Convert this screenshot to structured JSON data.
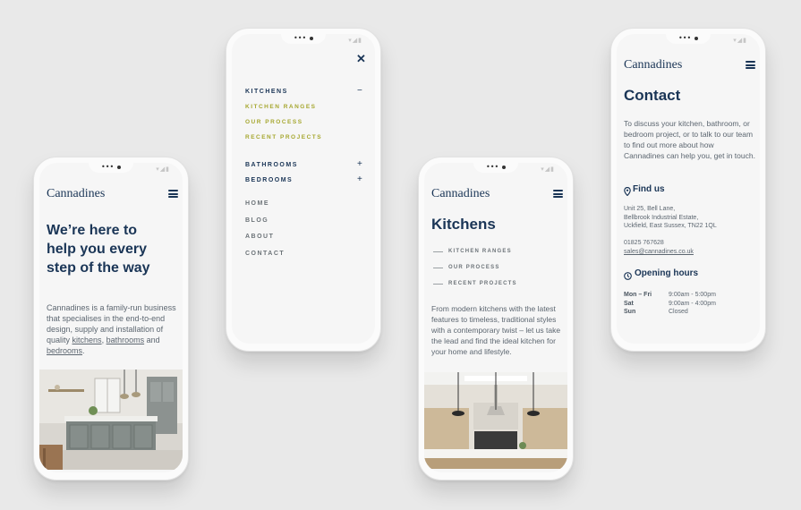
{
  "status_dots": "•••",
  "brand": "Cannadines",
  "phone1": {
    "headline": [
      "We’re here to",
      "help you every",
      "step of the way"
    ],
    "intro_text": "Cannadines is a family-run business that specialises in the end-to-end design, supply and installation of quality",
    "links": [
      "kitchens",
      "bathrooms",
      "bedrooms"
    ],
    "and": "and",
    "period": ".",
    "comma": ","
  },
  "phone2": {
    "kitchens": "KITCHENS",
    "kitchens_toggle": "−",
    "sub_items": [
      "KITCHEN RANGES",
      "OUR PROCESS",
      "RECENT PROJECTS"
    ],
    "bathrooms": "BATHROOMS",
    "bedrooms": "BEDROOMS",
    "expand_toggle": "+",
    "minor_items": [
      "HOME",
      "BLOG",
      "ABOUT",
      "CONTACT"
    ],
    "close": "✕"
  },
  "phone3": {
    "title": "Kitchens",
    "side_items": [
      "KITCHEN RANGES",
      "OUR PROCESS",
      "RECENT PROJECTS"
    ],
    "text": "From modern kitchens with the latest features to timeless, traditional styles with a contemporary twist – let us take the lead and find the ideal kitchen for your home and lifestyle."
  },
  "phone4": {
    "title": "Contact",
    "text": "To discuss your kitchen, bathroom, or bedroom project, or to talk to our team to find out more about how Cannadines can help you, get in touch.",
    "find_us": "Find us",
    "address": [
      "Unit 25, Bell Lane,",
      "Bellbrook Industrial Estate,",
      "Uckfield, East Sussex, TN22 1QL"
    ],
    "phone": "01825 767628",
    "email": "sales@cannadines.co.uk",
    "hours_title": "Opening hours",
    "hours": [
      {
        "day": "Mon – Fri",
        "time": "9:00am - 5:00pm"
      },
      {
        "day": "Sat",
        "time": "9:00am - 4:00pm"
      },
      {
        "day": "Sun",
        "time": "Closed"
      }
    ]
  },
  "colors": {
    "navy": "#1a3556",
    "olive": "#a6a72f",
    "grey_text": "#5c6670",
    "background": "#e9e9e9"
  }
}
